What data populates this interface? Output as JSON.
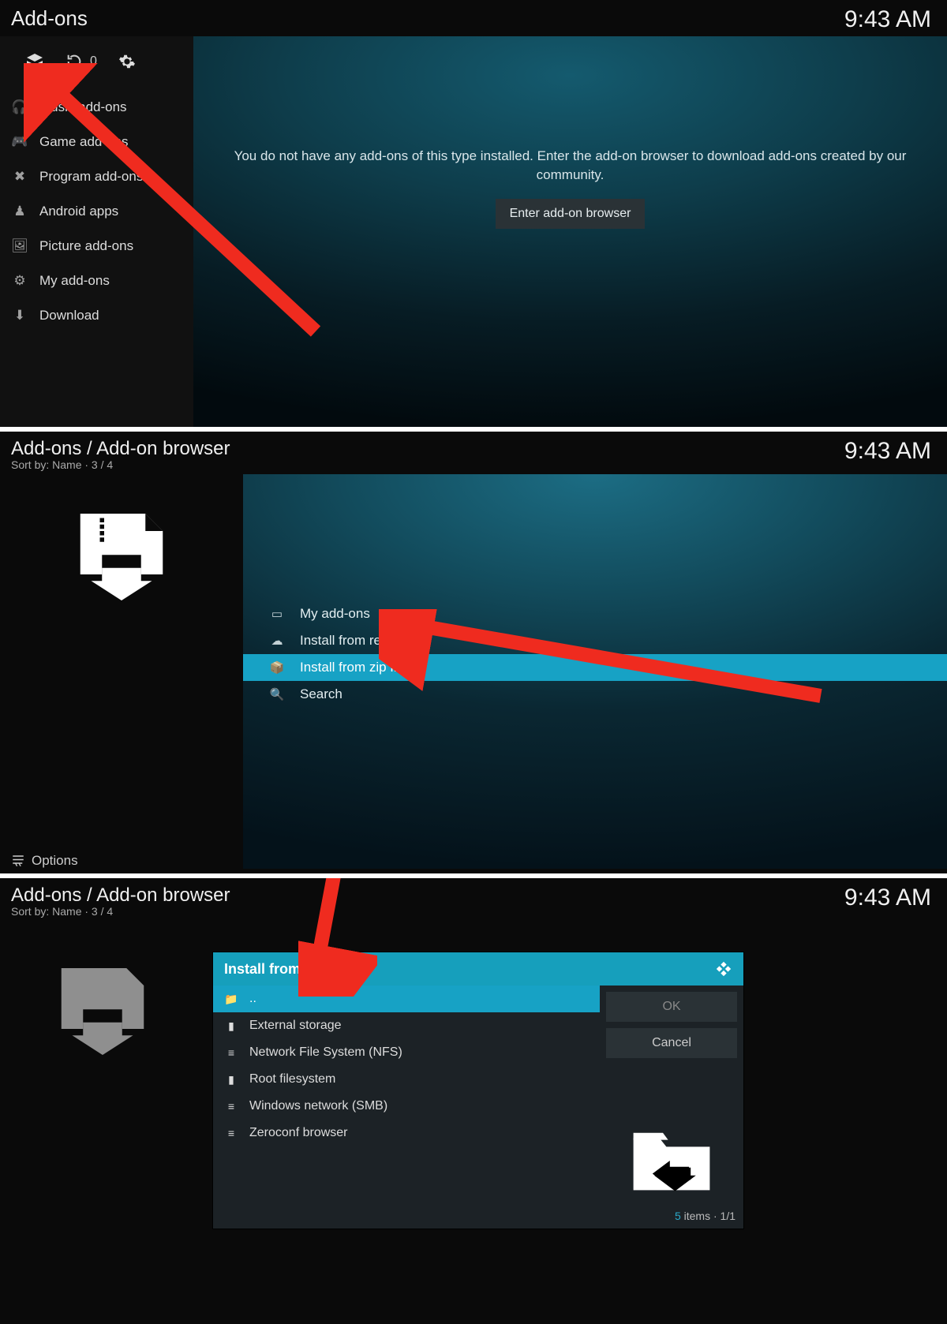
{
  "clock": "9:43 AM",
  "screen1": {
    "title": "Add-ons",
    "toolbar_count": "0",
    "sidebar": [
      {
        "icon": "headphones-icon",
        "label": "Music add-ons"
      },
      {
        "icon": "gamepad-icon",
        "label": "Game add-ons"
      },
      {
        "icon": "puzzle-icon",
        "label": "Program add-ons"
      },
      {
        "icon": "android-icon",
        "label": "Android apps"
      },
      {
        "icon": "picture-icon",
        "label": "Picture add-ons"
      },
      {
        "icon": "gears-icon",
        "label": "My add-ons"
      },
      {
        "icon": "download-icon",
        "label": "Download"
      }
    ],
    "empty_message": "You do not have any add-ons of this type installed. Enter the add-on browser to download add-ons created by our community.",
    "enter_button": "Enter add-on browser"
  },
  "screen2": {
    "title": "Add-ons / Add-on browser",
    "subtitle": "Sort by: Name  ·  3 / 4",
    "menu": [
      {
        "icon": "monitor-icon",
        "label": "My add-ons",
        "selected": false
      },
      {
        "icon": "cloud-down-icon",
        "label": "Install from repository",
        "selected": false
      },
      {
        "icon": "zip-icon",
        "label": "Install from zip file",
        "selected": true
      },
      {
        "icon": "search-icon",
        "label": "Search",
        "selected": false
      }
    ],
    "options_label": "Options"
  },
  "screen3": {
    "title": "Add-ons / Add-on browser",
    "subtitle": "Sort by: Name  ·  3 / 4",
    "dialog": {
      "title": "Install from zip file",
      "items": [
        {
          "icon": "folder-up-icon",
          "label": "..",
          "selected": true
        },
        {
          "icon": "sd-icon",
          "label": "External storage",
          "selected": false
        },
        {
          "icon": "network-icon",
          "label": "Network File System (NFS)",
          "selected": false
        },
        {
          "icon": "sd-icon",
          "label": "Root filesystem",
          "selected": false
        },
        {
          "icon": "network-icon",
          "label": "Windows network (SMB)",
          "selected": false
        },
        {
          "icon": "network-icon",
          "label": "Zeroconf browser",
          "selected": false
        }
      ],
      "ok_label": "OK",
      "cancel_label": "Cancel",
      "footer_count": "5",
      "footer_items_word": " items · ",
      "footer_page": "1/1"
    }
  }
}
